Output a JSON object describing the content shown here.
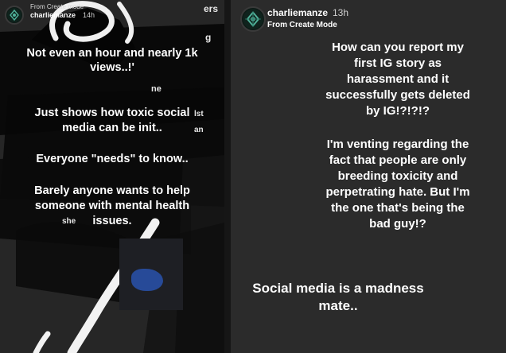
{
  "left": {
    "from_label": "From Create mode",
    "username": "charliemanze",
    "time": "14h",
    "fragment_ers": "ers",
    "fragment_g": "g",
    "fragment_ne": "ne",
    "fragment_lst": "lst",
    "fragment_an": "an",
    "fragment_she": "she",
    "lines": [
      "Not even an hour and nearly 1k",
      "views..!'",
      "Just shows how toxic social",
      "media can be init..",
      "Everyone \"needs\" to know..",
      "Barely anyone wants to help",
      "someone with mental health",
      "issues."
    ]
  },
  "right": {
    "username": "charliemanze",
    "time": "13h",
    "subtitle": "From Create Mode",
    "paragraph1": [
      "How can you report my",
      "first IG story as",
      "harassment and it",
      "successfully gets deleted",
      "by IG!?!?!?"
    ],
    "paragraph2": [
      "I'm venting regarding the",
      "fact that people are only",
      "breeding toxicity and",
      "perpetrating hate. But I'm",
      "the one that's being the",
      "bad guy!?"
    ],
    "paragraph3": [
      "Social media is a madness",
      "mate.."
    ]
  },
  "colors": {
    "left_bg": "#262626",
    "right_bg": "#2b2b2b",
    "text": "#ffffff",
    "scribble_black": "#060606",
    "scribble_white": "#f2f2f2"
  },
  "icons": {
    "avatar": "green-emblem-avatar"
  }
}
